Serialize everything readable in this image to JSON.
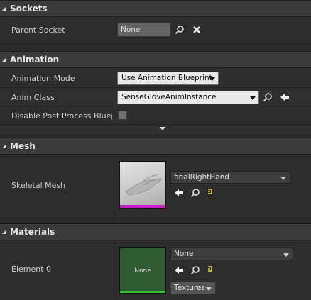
{
  "sections": {
    "sockets": {
      "title": "Sockets"
    },
    "animation": {
      "title": "Animation"
    },
    "mesh": {
      "title": "Mesh"
    },
    "materials": {
      "title": "Materials"
    }
  },
  "sockets": {
    "parent_socket": {
      "label": "Parent Socket",
      "value": "None"
    }
  },
  "animation": {
    "mode": {
      "label": "Animation Mode",
      "value": "Use Animation Blueprint"
    },
    "anim_class": {
      "label": "Anim Class",
      "value": "SenseGloveAnimInstance"
    },
    "disable_post": {
      "label": "Disable Post Process Blueprint",
      "checked": false
    }
  },
  "mesh": {
    "skeletal_mesh": {
      "label": "Skeletal Mesh",
      "value": "finalRightHand"
    }
  },
  "materials": {
    "element0": {
      "label": "Element 0",
      "value": "None",
      "thumb_text": "None",
      "textures_label": "Textures"
    }
  },
  "colors": {
    "mesh_underline": "#c81ec8",
    "material_underline": "#35c235",
    "material_thumb": "#2f5a32"
  },
  "icons": {
    "browse": "search-icon",
    "clear": "close-icon",
    "use_selected": "arrow-left-icon",
    "find": "asset-find-icon"
  }
}
